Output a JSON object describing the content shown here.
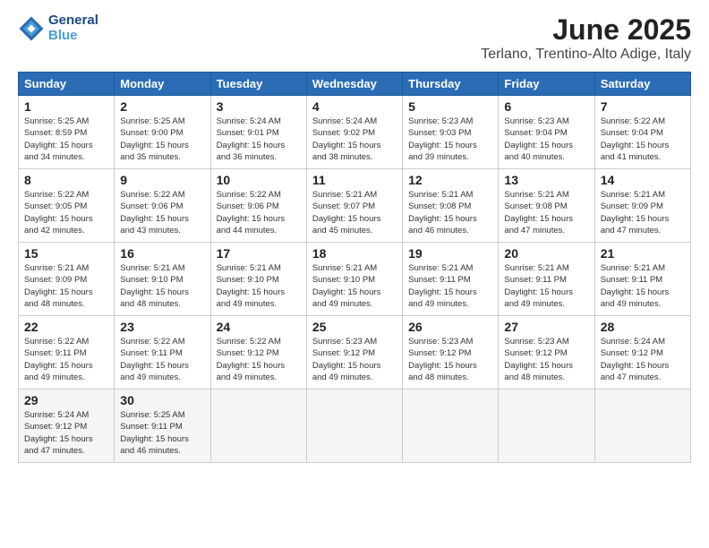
{
  "header": {
    "logo_line1": "General",
    "logo_line2": "Blue",
    "month_year": "June 2025",
    "location": "Terlano, Trentino-Alto Adige, Italy"
  },
  "weekdays": [
    "Sunday",
    "Monday",
    "Tuesday",
    "Wednesday",
    "Thursday",
    "Friday",
    "Saturday"
  ],
  "weeks": [
    [
      {
        "day": "1",
        "sunrise": "Sunrise: 5:25 AM",
        "sunset": "Sunset: 8:59 PM",
        "daylight": "Daylight: 15 hours and 34 minutes."
      },
      {
        "day": "2",
        "sunrise": "Sunrise: 5:25 AM",
        "sunset": "Sunset: 9:00 PM",
        "daylight": "Daylight: 15 hours and 35 minutes."
      },
      {
        "day": "3",
        "sunrise": "Sunrise: 5:24 AM",
        "sunset": "Sunset: 9:01 PM",
        "daylight": "Daylight: 15 hours and 36 minutes."
      },
      {
        "day": "4",
        "sunrise": "Sunrise: 5:24 AM",
        "sunset": "Sunset: 9:02 PM",
        "daylight": "Daylight: 15 hours and 38 minutes."
      },
      {
        "day": "5",
        "sunrise": "Sunrise: 5:23 AM",
        "sunset": "Sunset: 9:03 PM",
        "daylight": "Daylight: 15 hours and 39 minutes."
      },
      {
        "day": "6",
        "sunrise": "Sunrise: 5:23 AM",
        "sunset": "Sunset: 9:04 PM",
        "daylight": "Daylight: 15 hours and 40 minutes."
      },
      {
        "day": "7",
        "sunrise": "Sunrise: 5:22 AM",
        "sunset": "Sunset: 9:04 PM",
        "daylight": "Daylight: 15 hours and 41 minutes."
      }
    ],
    [
      {
        "day": "8",
        "sunrise": "Sunrise: 5:22 AM",
        "sunset": "Sunset: 9:05 PM",
        "daylight": "Daylight: 15 hours and 42 minutes."
      },
      {
        "day": "9",
        "sunrise": "Sunrise: 5:22 AM",
        "sunset": "Sunset: 9:06 PM",
        "daylight": "Daylight: 15 hours and 43 minutes."
      },
      {
        "day": "10",
        "sunrise": "Sunrise: 5:22 AM",
        "sunset": "Sunset: 9:06 PM",
        "daylight": "Daylight: 15 hours and 44 minutes."
      },
      {
        "day": "11",
        "sunrise": "Sunrise: 5:21 AM",
        "sunset": "Sunset: 9:07 PM",
        "daylight": "Daylight: 15 hours and 45 minutes."
      },
      {
        "day": "12",
        "sunrise": "Sunrise: 5:21 AM",
        "sunset": "Sunset: 9:08 PM",
        "daylight": "Daylight: 15 hours and 46 minutes."
      },
      {
        "day": "13",
        "sunrise": "Sunrise: 5:21 AM",
        "sunset": "Sunset: 9:08 PM",
        "daylight": "Daylight: 15 hours and 47 minutes."
      },
      {
        "day": "14",
        "sunrise": "Sunrise: 5:21 AM",
        "sunset": "Sunset: 9:09 PM",
        "daylight": "Daylight: 15 hours and 47 minutes."
      }
    ],
    [
      {
        "day": "15",
        "sunrise": "Sunrise: 5:21 AM",
        "sunset": "Sunset: 9:09 PM",
        "daylight": "Daylight: 15 hours and 48 minutes."
      },
      {
        "day": "16",
        "sunrise": "Sunrise: 5:21 AM",
        "sunset": "Sunset: 9:10 PM",
        "daylight": "Daylight: 15 hours and 48 minutes."
      },
      {
        "day": "17",
        "sunrise": "Sunrise: 5:21 AM",
        "sunset": "Sunset: 9:10 PM",
        "daylight": "Daylight: 15 hours and 49 minutes."
      },
      {
        "day": "18",
        "sunrise": "Sunrise: 5:21 AM",
        "sunset": "Sunset: 9:10 PM",
        "daylight": "Daylight: 15 hours and 49 minutes."
      },
      {
        "day": "19",
        "sunrise": "Sunrise: 5:21 AM",
        "sunset": "Sunset: 9:11 PM",
        "daylight": "Daylight: 15 hours and 49 minutes."
      },
      {
        "day": "20",
        "sunrise": "Sunrise: 5:21 AM",
        "sunset": "Sunset: 9:11 PM",
        "daylight": "Daylight: 15 hours and 49 minutes."
      },
      {
        "day": "21",
        "sunrise": "Sunrise: 5:21 AM",
        "sunset": "Sunset: 9:11 PM",
        "daylight": "Daylight: 15 hours and 49 minutes."
      }
    ],
    [
      {
        "day": "22",
        "sunrise": "Sunrise: 5:22 AM",
        "sunset": "Sunset: 9:11 PM",
        "daylight": "Daylight: 15 hours and 49 minutes."
      },
      {
        "day": "23",
        "sunrise": "Sunrise: 5:22 AM",
        "sunset": "Sunset: 9:11 PM",
        "daylight": "Daylight: 15 hours and 49 minutes."
      },
      {
        "day": "24",
        "sunrise": "Sunrise: 5:22 AM",
        "sunset": "Sunset: 9:12 PM",
        "daylight": "Daylight: 15 hours and 49 minutes."
      },
      {
        "day": "25",
        "sunrise": "Sunrise: 5:23 AM",
        "sunset": "Sunset: 9:12 PM",
        "daylight": "Daylight: 15 hours and 49 minutes."
      },
      {
        "day": "26",
        "sunrise": "Sunrise: 5:23 AM",
        "sunset": "Sunset: 9:12 PM",
        "daylight": "Daylight: 15 hours and 48 minutes."
      },
      {
        "day": "27",
        "sunrise": "Sunrise: 5:23 AM",
        "sunset": "Sunset: 9:12 PM",
        "daylight": "Daylight: 15 hours and 48 minutes."
      },
      {
        "day": "28",
        "sunrise": "Sunrise: 5:24 AM",
        "sunset": "Sunset: 9:12 PM",
        "daylight": "Daylight: 15 hours and 47 minutes."
      }
    ],
    [
      {
        "day": "29",
        "sunrise": "Sunrise: 5:24 AM",
        "sunset": "Sunset: 9:12 PM",
        "daylight": "Daylight: 15 hours and 47 minutes."
      },
      {
        "day": "30",
        "sunrise": "Sunrise: 5:25 AM",
        "sunset": "Sunset: 9:11 PM",
        "daylight": "Daylight: 15 hours and 46 minutes."
      },
      null,
      null,
      null,
      null,
      null
    ]
  ]
}
